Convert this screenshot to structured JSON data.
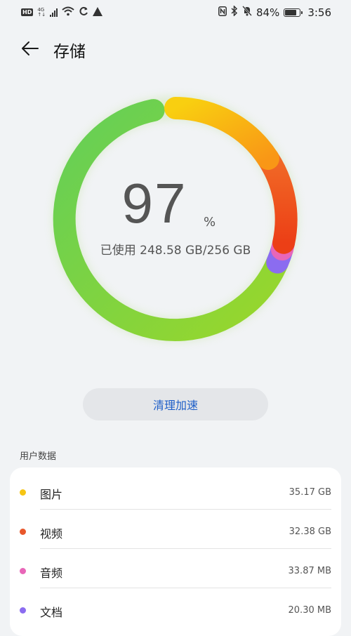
{
  "status_bar": {
    "hd": "HD",
    "net_top": "4G",
    "net_bottom": "↑↓",
    "battery_text": "84%",
    "battery_level": 0.84,
    "time": "3:56"
  },
  "header": {
    "title": "存储"
  },
  "storage": {
    "percent": "97",
    "percent_unit": "%",
    "usage_text": "已使用 248.58 GB/256 GB"
  },
  "actions": {
    "clean_label": "清理加速"
  },
  "user_data": {
    "section_label": "用户数据",
    "items": [
      {
        "label": "图片",
        "value": "35.17 GB",
        "color": "#f6c514"
      },
      {
        "label": "视频",
        "value": "32.38 GB",
        "color": "#e8572b"
      },
      {
        "label": "音频",
        "value": "33.87 MB",
        "color": "#e866b8"
      },
      {
        "label": "文档",
        "value": "20.30 MB",
        "color": "#8b6cf0"
      }
    ]
  }
}
